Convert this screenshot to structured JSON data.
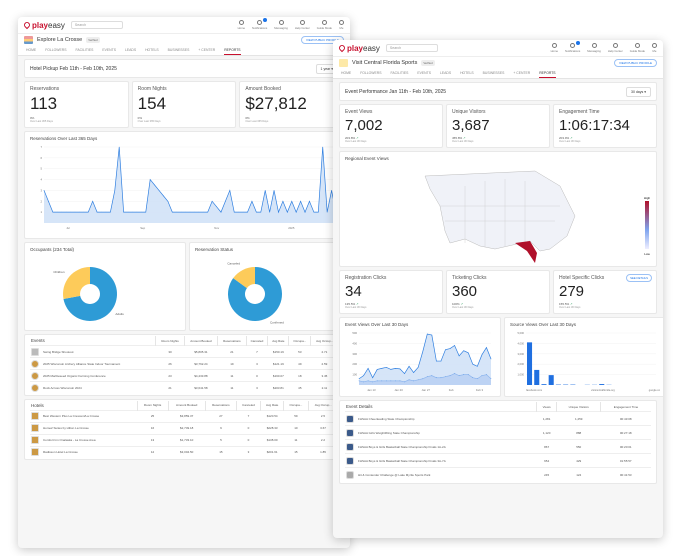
{
  "brand": {
    "name_a": "play",
    "name_b": "easy"
  },
  "nav": [
    "Home",
    "Notifications",
    "Messaging",
    "Help Center",
    "Guide Mode",
    "Me"
  ],
  "search_placeholder": "Search",
  "left": {
    "org": "Explore La Crosse",
    "org_tag": "Verified",
    "view_profile": "VIEW PUBLIC PROFILE",
    "tabs": [
      "HOME",
      "FOLLOWERS",
      "FACILITIES",
      "EVENTS",
      "LEADS",
      "HOTELS",
      "BUSINESSES",
      "+ CENTER",
      "REPORTS"
    ],
    "title": "Hotel Pickup Feb 11th - Feb 10th, 2025",
    "range": "1 year",
    "stats": [
      {
        "label": "Reservations",
        "value": "113",
        "change": "0%",
        "sub": "Over Last 365 Days"
      },
      {
        "label": "Room Nights",
        "value": "154",
        "change": "0%",
        "sub": "Over Last 365 Days"
      },
      {
        "label": "Amount Booked",
        "value": "$27,812",
        "change": "0%",
        "sub": "Over Last 365 Days"
      }
    ],
    "line_title": "Reservations Over Last 365 Days",
    "occupants_title": "Occupants (234 Total)",
    "status_title": "Reservation Status",
    "events_title": "Events",
    "hotels_title": "Hotels",
    "columns": [
      "Room Nights",
      "Amount Booked",
      "Reservations",
      "Canceled",
      "Avg Rate",
      "Occupa...",
      "Avg Occup..."
    ],
    "events": [
      [
        "Swing Bridge Shootout",
        "30",
        "$5,805.31",
        "21",
        "7",
        "$150.19",
        "53",
        "2.71"
      ],
      [
        "2025 Wisconsin Archery Alliance State Indoor Tournament",
        "26",
        "$3,762.24",
        "19",
        "3",
        "$121.19",
        "49",
        "2.59"
      ],
      [
        "2025 Marbleseed Organic Farming Conference",
        "23",
        "$4,433.88",
        "11",
        "0",
        "$160.07",
        "18",
        "3.45"
      ],
      [
        "Rock Across Wisconsin 2024",
        "21",
        "$3,641.58",
        "11",
        "3",
        "$203.81",
        "45",
        "2.11"
      ]
    ],
    "hotels": [
      [
        "Best Western Plus La Crescent/La Crosse",
        "25",
        "$3,859.37",
        "27",
        "7",
        "$120.54",
        "59",
        "2.5"
      ],
      [
        "Home2 Suites by Hilton La Crosse",
        "16",
        "$2,749.18",
        "9",
        "0",
        "$228.33",
        "10",
        "3.67"
      ],
      [
        "Comfort Inn Onalaska - La Crosse Area",
        "13",
        "$1,733.10",
        "5",
        "0",
        "$138.00",
        "11",
        "2.2"
      ],
      [
        "Radisson Hotel La Crosse",
        "12",
        "$3,004.50",
        "15",
        "3",
        "$201.61",
        "15",
        "1.85"
      ]
    ]
  },
  "right": {
    "org": "Visit Central Florida Sports",
    "org_tag": "Verified",
    "view_profile": "VIEW PUBLIC PROFILE",
    "tabs": [
      "HOME",
      "FOLLOWERS",
      "FACILITIES",
      "EVENTS",
      "LEADS",
      "HOTELS",
      "BUSINESSES",
      "+ CENTER",
      "REPORTS"
    ],
    "title": "Event Performance Jan 11th - Feb 10th, 2025",
    "range": "30 days",
    "stats": [
      {
        "label": "Event Views",
        "value": "7,002",
        "change": "203.8%",
        "sub": "Over Last 30 Days"
      },
      {
        "label": "Unique Visitors",
        "value": "3,687",
        "change": "455.8%",
        "sub": "Over Last 30 Days"
      },
      {
        "label": "Engagement Time",
        "value": "1:06:17:34",
        "change": "203.9%",
        "sub": "Over Last 30 Days"
      }
    ],
    "map_title": "Regional Event Views",
    "map_legend": {
      "high": "High",
      "low": "Low"
    },
    "stats2": [
      {
        "label": "Registration Clicks",
        "value": "34",
        "change": "135.5%",
        "sub": "Over Last 30 Days"
      },
      {
        "label": "Ticketing Clicks",
        "value": "360",
        "change": "100%",
        "sub": "Over Last 30 Days"
      },
      {
        "label": "Hotel Specific Clicks",
        "value": "279",
        "change": "155.5%",
        "sub": "Over Last 30 Days",
        "button": "SEE DETAILS"
      }
    ],
    "details_title": "Event Details",
    "details_columns": [
      "Views",
      "Unique Visitors",
      "Engagement Time"
    ],
    "details": [
      [
        "FHSAA Cheerleading State Championship",
        "1,281",
        "1,259",
        "00:43:08"
      ],
      [
        "FHSAA Girls Weightlifting State Championship",
        "1,120",
        "888",
        "00:27:18"
      ],
      [
        "FHSAA Boys & Girls Basketball State Championship Finals 1A-2A",
        "867",
        "550",
        "00:20:01"
      ],
      [
        "FHSAA Boys & Girls Basketball State Championship Finals 3A-7A",
        "654",
        "429",
        "01:55:57"
      ],
      [
        "Hit & Contender Challenge @ Lake Myrtle Sports Park",
        "245",
        "124",
        "00:41:53"
      ]
    ]
  },
  "colors": {
    "brand": "#c8102e",
    "line": "#2f7fe0",
    "fill": "#cfe0f7",
    "donut_main": "#2e9bd6",
    "donut_alt": "#fdcb5a",
    "bar": "#1f6fe0",
    "florida": "#b0102a"
  },
  "chart_data": [
    {
      "type": "area",
      "title": "Reservations Over Last 365 Days",
      "xticks": [
        "Jul",
        "Sep",
        "Nov",
        "2025"
      ],
      "ylim": [
        0,
        7
      ],
      "yticks": [
        1,
        2,
        3,
        4,
        5,
        6,
        7
      ],
      "values": [
        3,
        2,
        1,
        1,
        1,
        1,
        1,
        1,
        1,
        1,
        1,
        2,
        1,
        1,
        1,
        1,
        3,
        7,
        1,
        1,
        1,
        1,
        1,
        1,
        4,
        3.5,
        3,
        2.5,
        2,
        1,
        1,
        1,
        1,
        1,
        1,
        1,
        1,
        1,
        2,
        1.5,
        1,
        2,
        3,
        1,
        1,
        1,
        1,
        2,
        1,
        1,
        3,
        1,
        3,
        1,
        2,
        1,
        2,
        1,
        2,
        1,
        2,
        1,
        1,
        7,
        1,
        3,
        1
      ]
    },
    {
      "type": "pie",
      "title": "Occupants (234 Total)",
      "labels": [
        "Adults",
        "Children"
      ],
      "values": [
        72,
        28
      ]
    },
    {
      "type": "pie",
      "title": "Reservation Status",
      "labels": [
        "Confirmed",
        "Canceled"
      ],
      "values": [
        85,
        15
      ]
    },
    {
      "type": "area",
      "title": "Event Views Over Last 30 Days",
      "xticks": [
        "Jan 13",
        "Jan 20",
        "Jan 27",
        "Feb",
        "Feb 3"
      ],
      "ylim": [
        0,
        500
      ],
      "yticks": [
        100,
        200,
        300,
        400,
        500
      ],
      "series": [
        {
          "values": [
            60,
            90,
            160,
            70,
            150,
            160,
            170,
            150,
            160,
            155,
            110,
            180,
            120,
            170,
            320,
            490,
            480,
            230,
            230,
            340,
            350,
            380,
            280,
            330,
            310,
            200,
            180,
            290,
            360,
            250
          ]
        },
        {
          "values": [
            40,
            30,
            40,
            30,
            40,
            40,
            40,
            40,
            40,
            40,
            30,
            50,
            40,
            50,
            60,
            80,
            90,
            70,
            70,
            80,
            90,
            110,
            90,
            100,
            100,
            70,
            60,
            90,
            100,
            60
          ]
        }
      ]
    },
    {
      "type": "bar",
      "title": "Source Views Over Last 30 Days",
      "ylim": [
        0,
        5000
      ],
      "yticks": [
        "1,000",
        "2,000",
        "3,000",
        "4,000",
        "5,000"
      ],
      "categories": [
        "facebook.com",
        "",
        "",
        "",
        "",
        "",
        "",
        "",
        "",
        "visitcentralflorida.org",
        "",
        "",
        "",
        "",
        "",
        "",
        "",
        "google.com"
      ],
      "values": [
        4100,
        1450,
        80,
        950,
        40,
        40,
        40,
        0,
        20,
        20,
        90,
        20,
        0,
        0,
        0,
        0,
        0,
        0
      ]
    }
  ]
}
